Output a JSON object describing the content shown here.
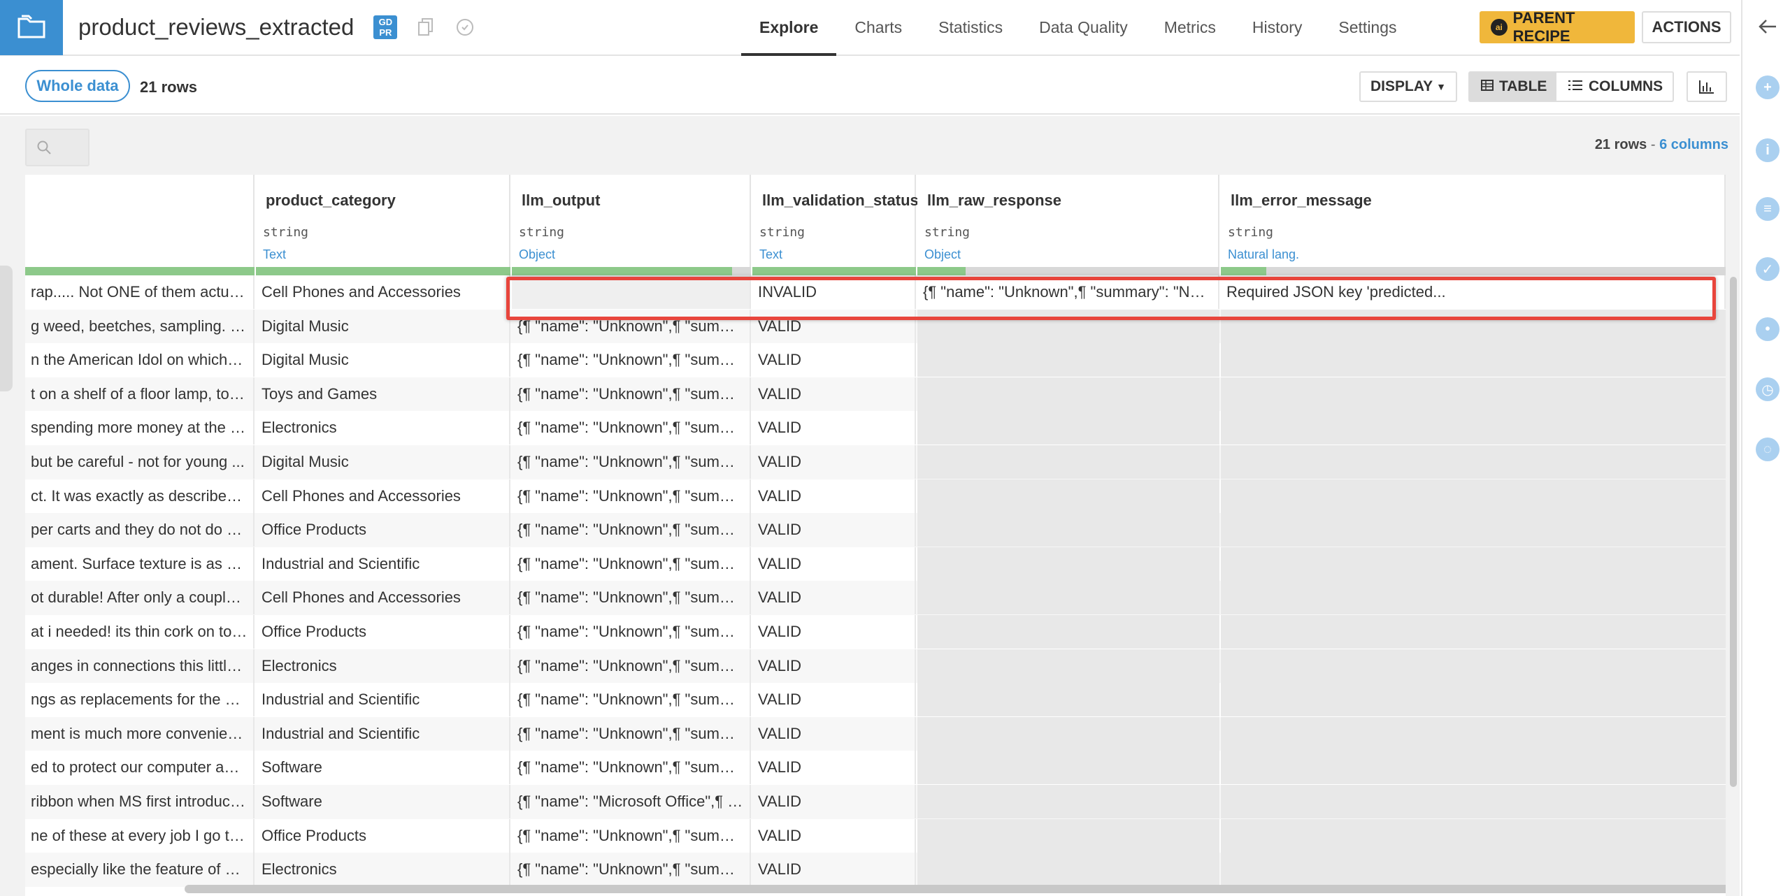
{
  "header": {
    "title": "product_reviews_extracted",
    "gdpr": "GD PR",
    "nav": [
      "Explore",
      "Charts",
      "Statistics",
      "Data Quality",
      "Metrics",
      "History",
      "Settings"
    ],
    "parent_recipe": "PARENT RECIPE",
    "parent_badge": "ai",
    "actions": "ACTIONS"
  },
  "toolbar": {
    "sample": "Whole data",
    "rows": "21 rows",
    "display": "DISPLAY",
    "table": "TABLE",
    "columns": "COLUMNS"
  },
  "summary": {
    "rows": "21 rows",
    "sep": " - ",
    "columns": "6 columns"
  },
  "columns": [
    {
      "name": "",
      "type": "",
      "meaning": ""
    },
    {
      "name": "product_category",
      "type": "string",
      "meaning": "Text"
    },
    {
      "name": "llm_output",
      "type": "string",
      "meaning": "Object"
    },
    {
      "name": "llm_validation_status",
      "type": "string",
      "meaning": "Text"
    },
    {
      "name": "llm_raw_response",
      "type": "string",
      "meaning": "Object"
    },
    {
      "name": "llm_error_message",
      "type": "string",
      "meaning": "Natural lang."
    }
  ],
  "quality": [
    1,
    1,
    0.92,
    1,
    0.16,
    0.09
  ],
  "rows": [
    [
      "rap..... Not ONE of them actual...",
      "Cell Phones and Accessories",
      "",
      "INVALID",
      "{¶  \"name\": \"Unknown\",¶  \"summary\": \"Not recom...",
      "Required JSON key 'predicted..."
    ],
    [
      "g weed, beetches, sampling. I ...",
      "Digital Music",
      "{¶  \"name\": \"Unknown\",¶  \"summary\": \"I was hopin...",
      "VALID",
      "",
      ""
    ],
    [
      "n the American Idol on whichev...",
      "Digital Music",
      "{¶  \"name\": \"Unknown\",¶  \"summary\": \"I saw him a...",
      "VALID",
      "",
      ""
    ],
    [
      "t on a shelf of a floor lamp, to c...",
      "Toys and Games",
      "{¶  \"name\": \"Unknown\",¶  \"summary\": \"Purchased ...",
      "VALID",
      "",
      ""
    ],
    [
      "spending more money at the V...",
      "Electronics",
      "{¶  \"name\": \"Unknown\",¶  \"summary\": \"A nice alter...",
      "VALID",
      "",
      ""
    ],
    [
      " but be careful - not for young ...",
      "Digital Music",
      "{¶  \"name\": \"Unknown\",¶  \"summary\": \"Like all the ...",
      "VALID",
      "",
      ""
    ],
    [
      "ct. It was exactly as described ...",
      "Cell Phones and Accessories",
      "{¶  \"name\": \"Unknown\",¶  \"summary\": \"Thanks for ...",
      "VALID",
      "",
      ""
    ],
    [
      "per carts and they do not do w...",
      "Office Products",
      "{¶  \"name\": \"Unknown\",¶  \"summary\": \"I have tried...",
      "VALID",
      "",
      ""
    ],
    [
      "ament. Surface texture is as ex...",
      "Industrial and Scientific",
      "{¶  \"name\": \"Unknown\",¶  \"summary\": \"Very good ...",
      "VALID",
      "",
      ""
    ],
    [
      "ot durable! After only a couple ...",
      "Cell Phones and Accessories",
      "{¶  \"name\": \"Unknown\",¶  \"summary\": \"Not bad bu...",
      "VALID",
      "",
      ""
    ],
    [
      "at i needed! its thin cork on top...",
      "Office Products",
      "{¶  \"name\": \"Unknown\",¶  \"summary\": \"perfect for ...",
      "VALID",
      "",
      ""
    ],
    [
      "anges in connections this little...",
      "Electronics",
      "{¶  \"name\": \"Unknown\",¶  \"summary\": \"With the co...",
      "VALID",
      "",
      ""
    ],
    [
      "ngs as replacements for the on...",
      "Industrial and Scientific",
      "{¶  \"name\": \"Unknown\",¶  \"summary\": \"Replaces n...",
      "VALID",
      "",
      ""
    ],
    [
      "ment is much more convenien...",
      "Industrial and Scientific",
      "{¶  \"name\": \"Unknown\",¶  \"summary\": \"The magne...",
      "VALID",
      "",
      ""
    ],
    [
      "ed to protect our computer and...",
      "Software",
      "{¶  \"name\": \"Unknown\",¶  \"summary\": \"Just what ...",
      "VALID",
      "",
      ""
    ],
    [
      "ribbon when MS first introduce...",
      "Software",
      "{¶  \"name\": \"Microsoft Office\",¶  \"summary\": \"Impr...",
      "VALID",
      "",
      ""
    ],
    [
      "ne of these at every job I go to. ...",
      "Office Products",
      "{¶  \"name\": \"Unknown\",¶  \"summary\": \"I make sur...",
      "VALID",
      "",
      ""
    ],
    [
      "especially like the feature of be...",
      "Electronics",
      "{¶  \"name\": \"Unknown\",¶  \"summary\": \"excellent p...",
      "VALID",
      "",
      ""
    ]
  ],
  "colors": {
    "accent": "#3b8fd1",
    "parent_recipe": "#f0b73b",
    "valid_bar": "#8dc98a",
    "highlight": "#e8453c"
  }
}
